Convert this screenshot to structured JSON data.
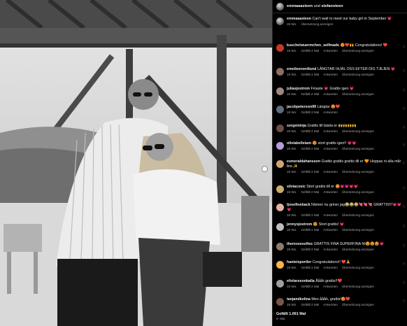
{
  "post": {
    "author": "emmaaasteen",
    "connector": "und",
    "coauthor": "stefansteen"
  },
  "caption": {
    "username": "emmaaasteen",
    "text": "Can't wait to meet our baby girl in September 💗",
    "age": "18 Wo.",
    "translate": "Übersetzung anzeigen"
  },
  "comments": [
    {
      "username": "kuschelwuermchen_selfmade",
      "text": "😍❤️🙌 Congratulations! ❤️",
      "age": "18 Wo.",
      "likes": "Gefällt 2 Mal",
      "reply": "Antworten",
      "translate": "Übersetzung anzeigen",
      "avatar_color": "#c0392b"
    },
    {
      "username": "emelieenordlund",
      "text": "LÄNGTAR IHJÄL OSS EFTER DIG TJEJEN 💗",
      "age": "18 Wo.",
      "likes": "Gefällt 2 Mal",
      "reply": "Antworten",
      "translate": "Übersetzung anzeigen",
      "avatar_color": "#8d6e63"
    },
    {
      "username": "juliasjostrom",
      "text": "Finaste 💗 Grattis igen 💗",
      "age": "18 Wo.",
      "likes": "Gefällt 2 Mal",
      "reply": "Antworten",
      "translate": "Übersetzung anzeigen",
      "avatar_color": "#a1887f"
    },
    {
      "username": "jacobpeterson99",
      "text": "Längtar 😍❤️",
      "age": "18 Wo.",
      "likes": "Gefällt 3 Mal",
      "reply": "Antworten",
      "translate": "",
      "avatar_color": "#5d6d7e"
    },
    {
      "username": "sergeininja",
      "text": "Grattis till bästa er 🙌🙌🙌🙌",
      "age": "18 Wo.",
      "likes": "Gefällt 2 Mal",
      "reply": "Antworten",
      "translate": "Übersetzung anzeigen",
      "avatar_color": "#6d4c41"
    },
    {
      "username": "oliviabellstam",
      "text": "😍 stort grattis igen!! 💗💗",
      "age": "18 Wo.",
      "likes": "Gefällt 2 Mal",
      "reply": "Antworten",
      "translate": "Übersetzung anzeigen",
      "avatar_color": "#b39ddb"
    },
    {
      "username": "esmeraldahansson",
      "text": "Grattis grattis grattis till er 🧡 Hoppas ni alla mår bra ✨",
      "age": "18 Wo.",
      "likes": "Gefällt 2 Mal",
      "reply": "Antworten",
      "translate": "Übersetzung anzeigen",
      "avatar_color": "#d4a373"
    },
    {
      "username": "silviacosic",
      "text": "Stort grattis till er 😍💗💗💗💗",
      "age": "18 Wo.",
      "likes": "Gefällt 2 Mal",
      "reply": "Antworten",
      "translate": "Übersetzung anzeigen",
      "avatar_color": "#c9a96e"
    },
    {
      "username": "ljosefineback",
      "text": "Nämen nu griner jag😂😂😂💘💘💘 GRATTIS!!!💗💗💗",
      "age": "18 Wo.",
      "likes": "Gefällt 2 Mal",
      "reply": "Antworten",
      "translate": "Übersetzung anzeigen",
      "avatar_color": "#e0b0a0"
    },
    {
      "username": "jennysjostrom",
      "text": "😍 Stort grattis! 💗",
      "age": "18 Wo.",
      "likes": "Gefällt 2 Mal",
      "reply": "Antworten",
      "translate": "Übersetzung anzeigen",
      "avatar_color": "#bdbdbd"
    },
    {
      "username": "theressesofies",
      "text": "GRATTIS FINA SUPERFINA NI😍😍😍💗",
      "age": "18 Wo.",
      "likes": "Gefällt 2 Mal",
      "reply": "Antworten",
      "translate": "Übersetzung anzeigen",
      "avatar_color": "#8e7a6b"
    },
    {
      "username": "hanteisportler",
      "text": "Congratulations!! ❤️🙏",
      "age": "18 Wo.",
      "likes": "Gefällt 2 Mal",
      "reply": "Antworten",
      "translate": "Übersetzung anzeigen",
      "avatar_color": "#ffb347"
    },
    {
      "username": "elinlarssonkalla",
      "text": "Åååh grattis!!❤️",
      "age": "18 Wo.",
      "likes": "Gefällt 2 Mal",
      "reply": "Antworten",
      "translate": "Übersetzung anzeigen",
      "avatar_color": "#9e9e9e"
    },
    {
      "username": "tanjamikolina",
      "text": "Men åååh, grattis!😍❤️",
      "age": "18 Wo.",
      "likes": "Gefällt 2 Mal",
      "reply": "Antworten",
      "translate": "Übersetzung anzeigen",
      "avatar_color": "#795548"
    }
  ],
  "footer": {
    "likes": "Gefällt 1.061 Mal",
    "date": "8. Mai"
  },
  "icons": [
    "heart-icon",
    "carousel-dot-icon"
  ]
}
